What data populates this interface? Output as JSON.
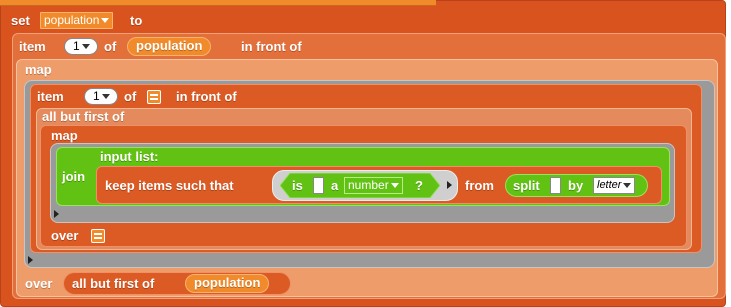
{
  "colors": {
    "list_block": "#d9531e",
    "list_block_light": "#e58a5c",
    "list_block_lighter": "#ee9c6a",
    "variable": "#f08a2a",
    "ring_gray": "#9a9a9a",
    "operators": "#62c213"
  },
  "set_block": {
    "keyword_set": "set",
    "variable": "population",
    "keyword_to": "to"
  },
  "item_block_outer": {
    "keyword_item": "item",
    "index": "1",
    "keyword_of": "of",
    "variable": "population",
    "keyword_infront": "in front of"
  },
  "map_outer": {
    "keyword_map": "map",
    "keyword_over": "over",
    "over_block": {
      "keyword": "all but first of",
      "variable": "population"
    }
  },
  "item_block_inner": {
    "keyword_item": "item",
    "index": "1",
    "keyword_of": "of",
    "keyword_infront": "in front of"
  },
  "all_but_first": {
    "keyword": "all but first of"
  },
  "map_inner": {
    "keyword_map": "map",
    "keyword_over": "over"
  },
  "join_block": {
    "keyword_join": "join",
    "keyword_input_list": "input list:"
  },
  "keep_block": {
    "keyword": "keep items such that",
    "keyword_from": "from"
  },
  "is_block": {
    "keyword_is": "is",
    "keyword_a": "a",
    "type": "number",
    "question": "?"
  },
  "split_block": {
    "keyword_split": "split",
    "keyword_by": "by",
    "separator": "letter"
  }
}
